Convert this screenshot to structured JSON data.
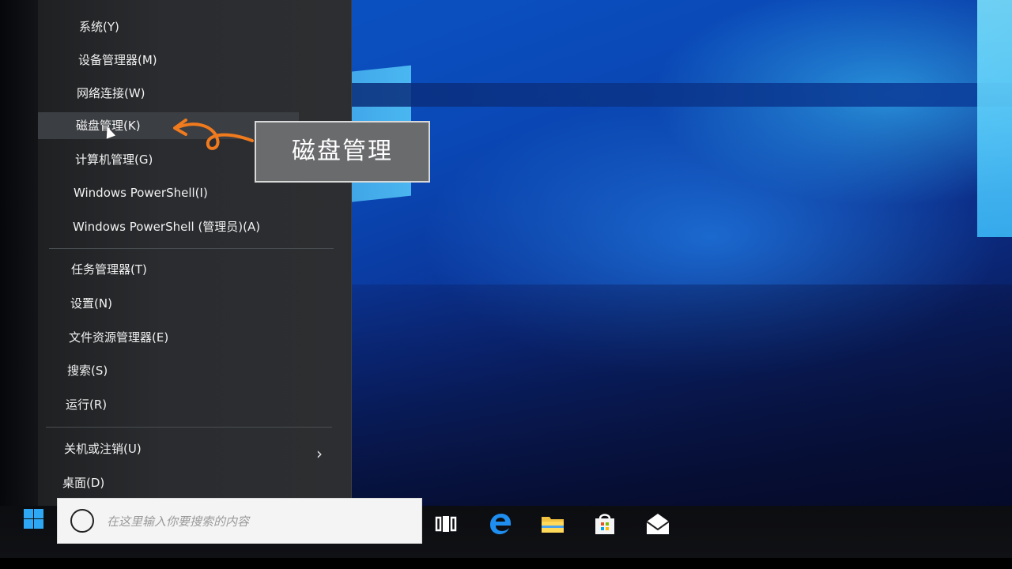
{
  "menu": {
    "items": [
      {
        "label": "系统(Y)"
      },
      {
        "label": "设备管理器(M)"
      },
      {
        "label": "网络连接(W)"
      },
      {
        "label": "磁盘管理(K)"
      },
      {
        "label": "计算机管理(G)"
      },
      {
        "label": "Windows PowerShell(I)"
      },
      {
        "label": "Windows PowerShell (管理员)(A)"
      },
      {
        "label": "任务管理器(T)"
      },
      {
        "label": "设置(N)"
      },
      {
        "label": "文件资源管理器(E)"
      },
      {
        "label": "搜索(S)"
      },
      {
        "label": "运行(R)"
      },
      {
        "label": "关机或注销(U)"
      },
      {
        "label": "桌面(D)"
      }
    ],
    "active_index": 3
  },
  "annotation": {
    "label": "磁盘管理",
    "arrow_color": "#f07a1e"
  },
  "taskbar": {
    "search_placeholder": "在这里输入你要搜索的内容",
    "icons": [
      "windows-start-icon",
      "task-view-icon",
      "edge-browser-icon",
      "file-explorer-icon",
      "store-icon",
      "mail-icon"
    ]
  },
  "colors": {
    "accent": "#2ea8f4",
    "menu_bg": "#2b2d30",
    "annotation_bg": "#6a6b6d"
  }
}
